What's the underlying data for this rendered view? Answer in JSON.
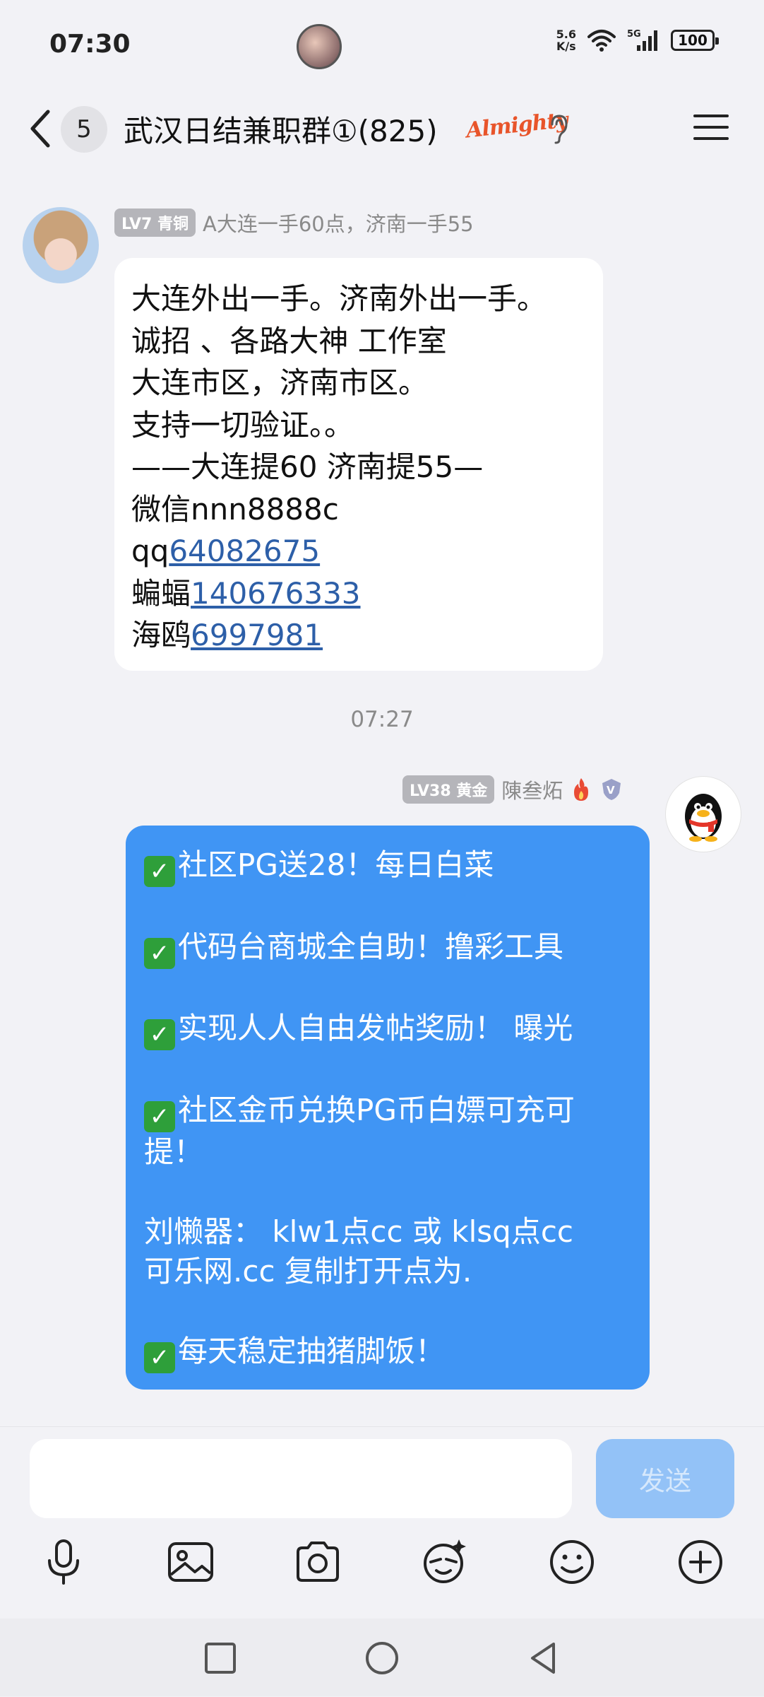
{
  "status_bar": {
    "time": "07:30",
    "net_speed_value": "5.6",
    "net_speed_unit": "K/s",
    "battery": "100",
    "icons": [
      "wifi-icon",
      "signal-5g-icon",
      "battery-icon"
    ]
  },
  "header": {
    "unread_count": "5",
    "title": "武汉日结兼职群①(825)",
    "brand_text": "Almighty",
    "icons": [
      "back-icon",
      "ear-icon",
      "menu-icon"
    ]
  },
  "messages": [
    {
      "sender_level": "LV7 青铜",
      "sender_name": "A大连一手60点，济南一手55",
      "lines": [
        {
          "text": "大连外出一手。济南外出一手。"
        },
        {
          "text": "诚招 、各路大神 工作室"
        },
        {
          "text": "大连市区，济南市区。"
        },
        {
          "text": "支持一切验证。。"
        },
        {
          "text": "——大连提60 济南提55—"
        },
        {
          "text": "微信nnn8888c"
        },
        {
          "prefix": "qq",
          "link": "64082675"
        },
        {
          "prefix": "蝙蝠",
          "link": "140676333"
        },
        {
          "prefix": "海鸥",
          "link": "6997981"
        }
      ]
    },
    {
      "time_divider": "07:27",
      "sender_level": "LV38 黄金",
      "sender_name": "陳叁炻",
      "lines": [
        "社区PG送28！每日白菜",
        "代码台商城全自助！撸彩工具",
        "实现人人自由发帖奖励！ 曝光",
        "社区金币兑换PG币白嫖可充可",
        "提！",
        "刘懒器： klw1点cc 或 klsq点cc",
        "可乐网.cc  复制打开点为.",
        "每天稳定抽猪脚饭！"
      ],
      "check_mark": "✓"
    }
  ],
  "composer": {
    "send_label": "发送",
    "tools": [
      "microphone-icon",
      "image-icon",
      "camera-icon",
      "sticker-icon",
      "emoji-icon",
      "plus-icon"
    ]
  },
  "nav": [
    "recents-icon",
    "home-icon",
    "back-nav-icon"
  ],
  "colors": {
    "bubble_self": "#4095f4",
    "link": "#2d5fa8",
    "send_disabled": "#93c2f7",
    "level_badge": "#b5b5ba"
  }
}
